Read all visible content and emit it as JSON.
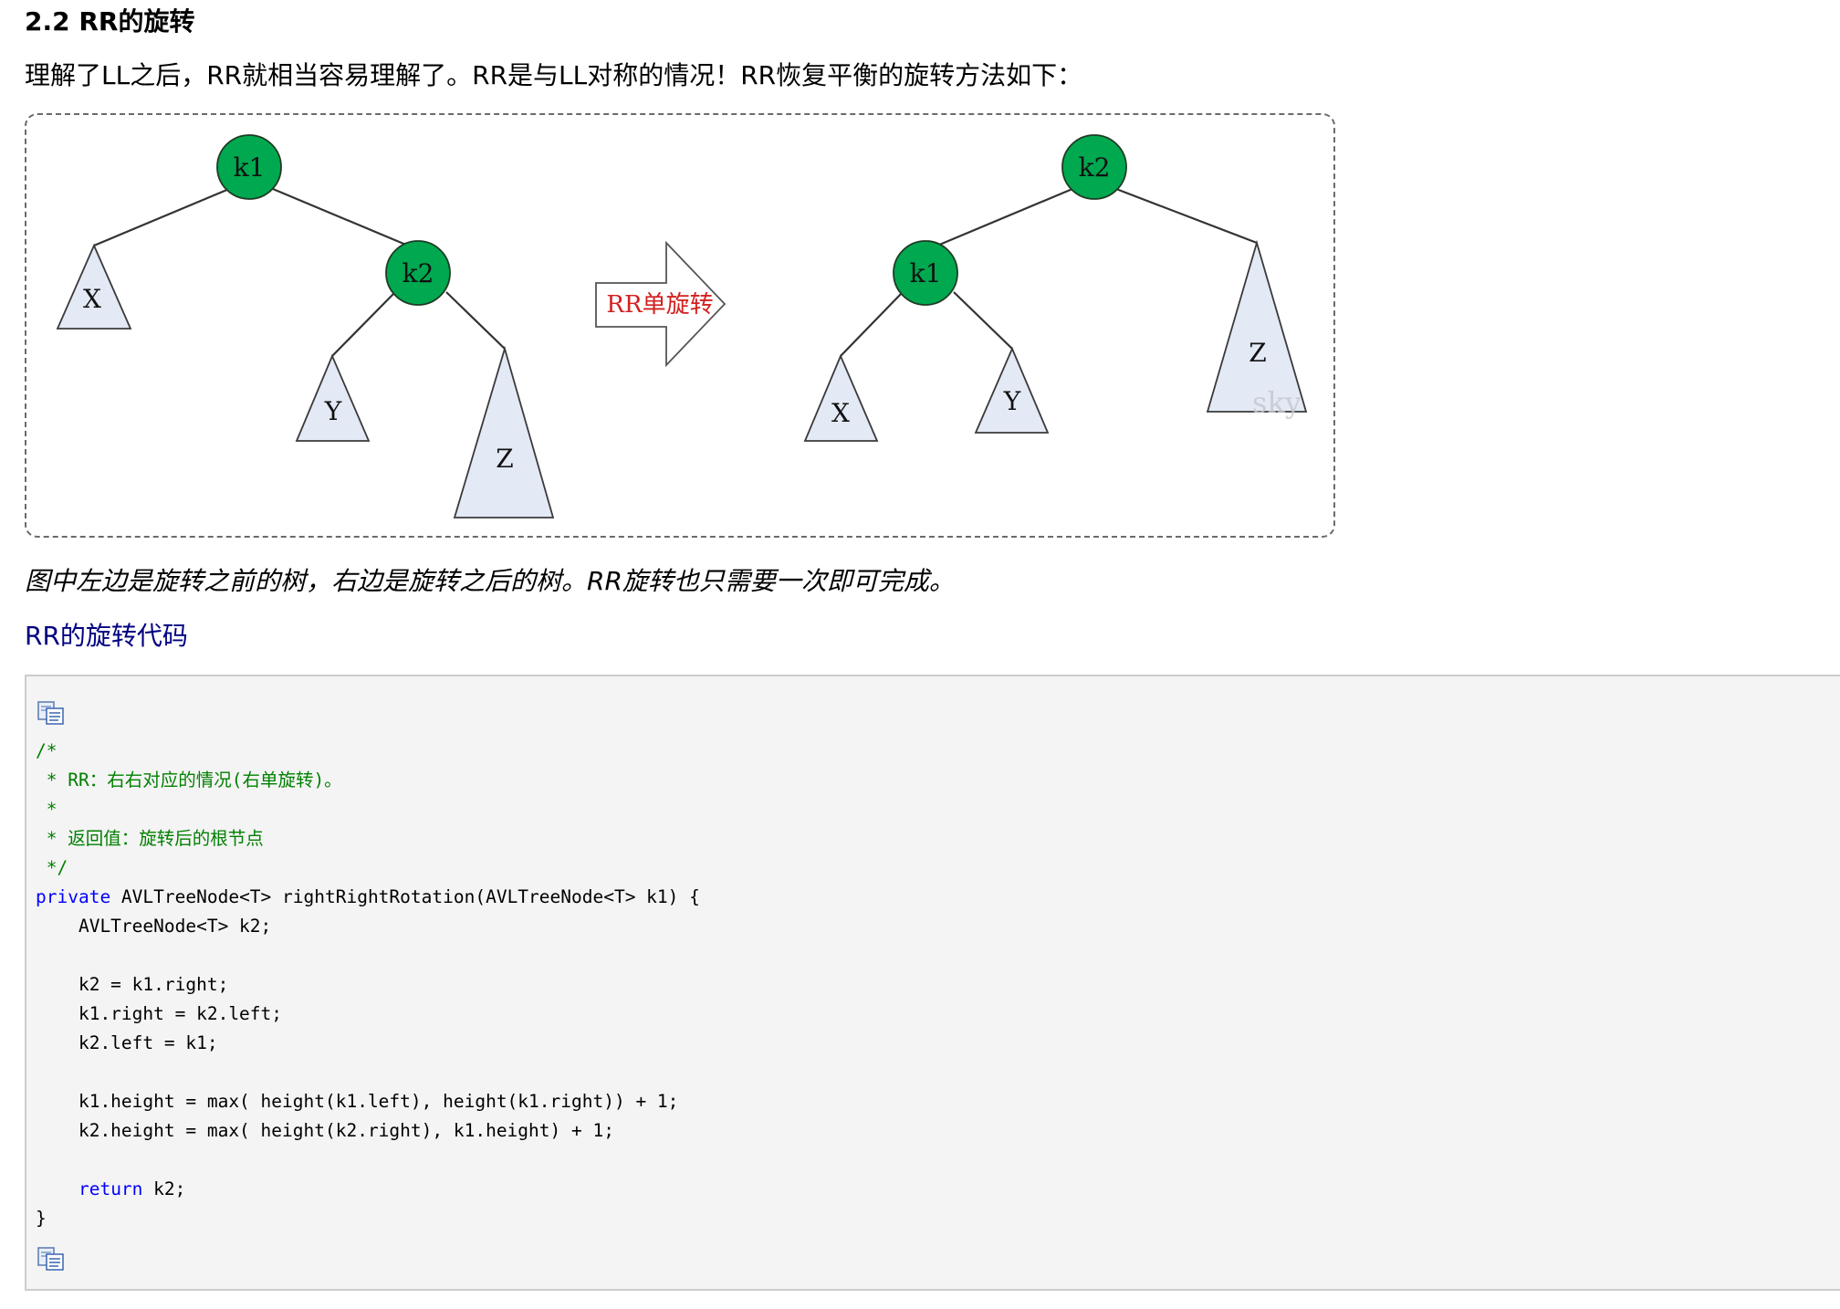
{
  "section": {
    "heading": "2.2 RR的旋转",
    "intro": "理解了LL之后，RR就相当容易理解了。RR是与LL对称的情况！RR恢复平衡的旋转方法如下："
  },
  "figure": {
    "arrow_label": "RR单旋转",
    "watermark": "sky",
    "before": {
      "k1": "k1",
      "k2": "k2",
      "x": "X",
      "y": "Y",
      "z": "Z"
    },
    "after": {
      "k1": "k1",
      "k2": "k2",
      "x": "X",
      "y": "Y",
      "z": "Z"
    },
    "colors": {
      "node_fill": "#00a84f",
      "subtree_fill": "#e3e9f5",
      "arrow_text": "#d32020",
      "dash_border": "#6b6b6b"
    }
  },
  "caption": "图中左边是旋转之前的树，右边是旋转之后的树。RR旋转也只需要一次即可完成。",
  "code_section": {
    "title": "RR的旋转代码",
    "copy_icon": "copy-code-icon",
    "lines": {
      "c1": "/*",
      "c2": " * RR：右右对应的情况(右单旋转)。",
      "c3": " *",
      "c4": " * 返回值：旋转后的根节点",
      "c5": " */",
      "l6_kw": "private",
      "l6_rest": " AVLTreeNode<T> rightRightRotation(AVLTreeNode<T> k1) {",
      "l7": "    AVLTreeNode<T> k2;",
      "l8": "",
      "l9": "    k2 = k1.right;",
      "l10": "    k1.right = k2.left;",
      "l11": "    k2.left = k1;",
      "l12": "",
      "l13": "    k1.height = max( height(k1.left), height(k1.right)) + 1;",
      "l14": "    k2.height = max( height(k2.right), k1.height) + 1;",
      "l15": "",
      "l16_indent": "    ",
      "l16_kw": "return",
      "l16_rest": " k2;",
      "l17": "}"
    }
  }
}
